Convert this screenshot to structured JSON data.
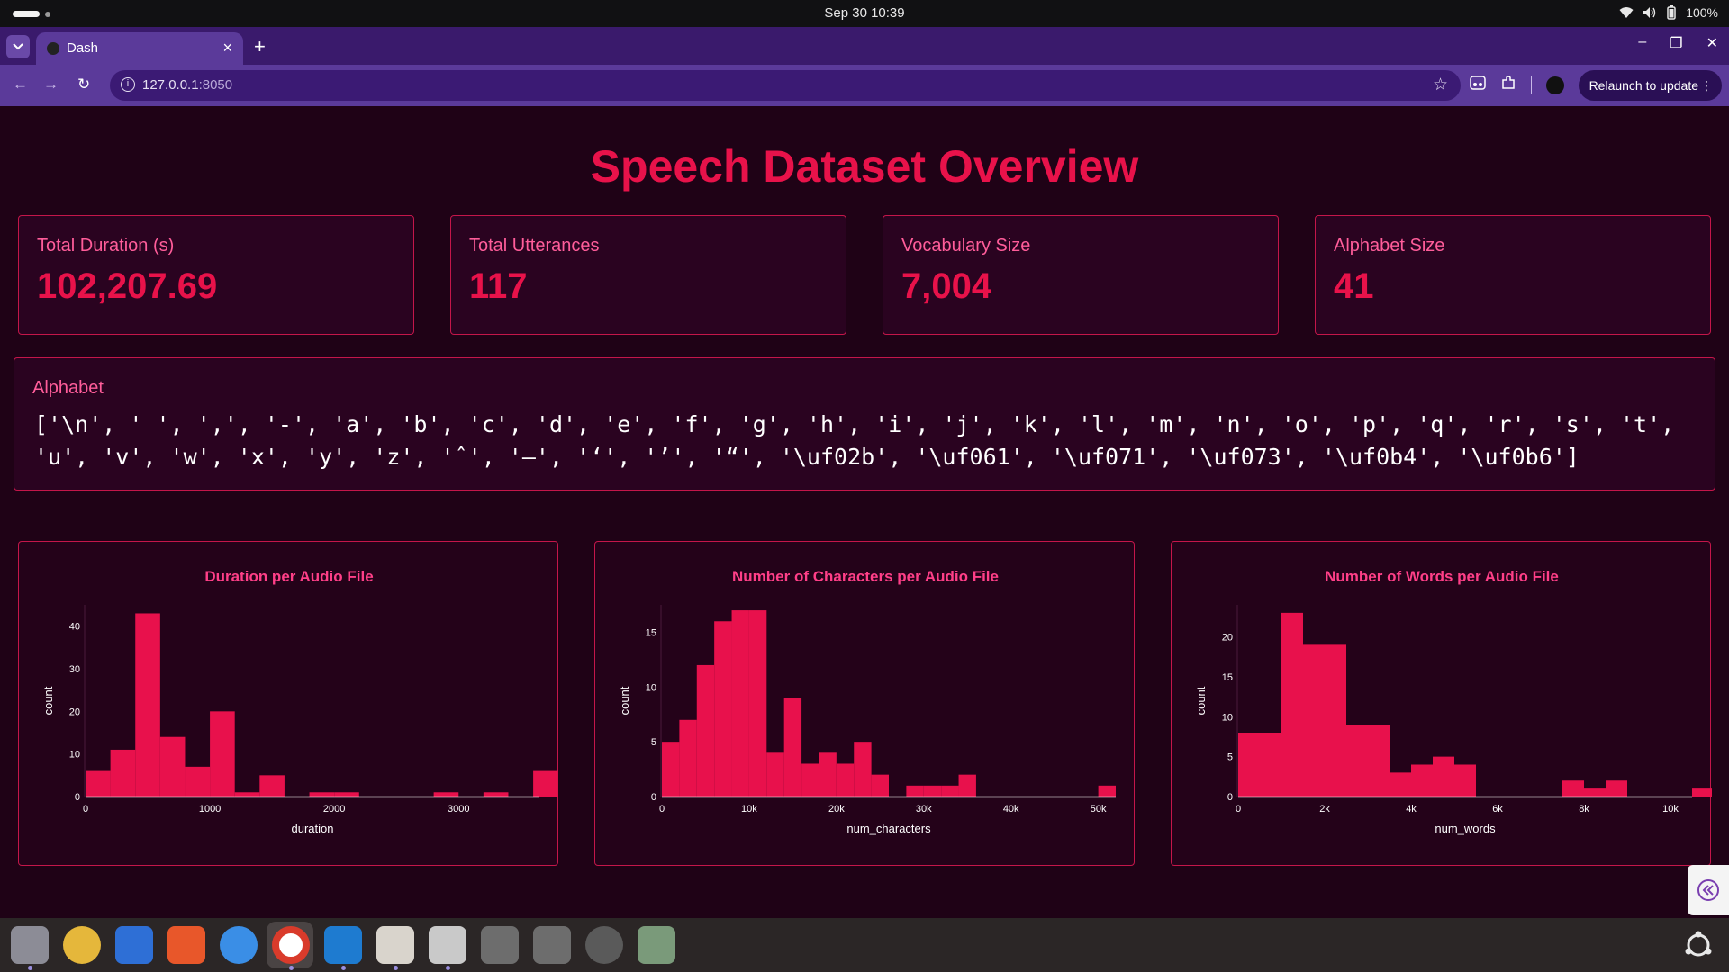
{
  "system": {
    "clock": "Sep 30  10:39",
    "battery": "100%"
  },
  "browser": {
    "tab_title": "Dash",
    "url_host": "127.0.0.1",
    "url_port": ":8050",
    "relaunch_label": "Relaunch to update"
  },
  "page": {
    "title": "Speech Dataset Overview",
    "stats": [
      {
        "label": "Total Duration (s)",
        "value": "102,207.69"
      },
      {
        "label": "Total Utterances",
        "value": "117"
      },
      {
        "label": "Vocabulary Size",
        "value": "7,004"
      },
      {
        "label": "Alphabet Size",
        "value": "41"
      }
    ],
    "alphabet": {
      "label": "Alphabet",
      "chars": "['\\n', ' ', ',', '-', 'a', 'b', 'c', 'd', 'e', 'f', 'g', 'h', 'i', 'j', 'k', 'l', 'm', 'n', 'o', 'p', 'q', 'r', 's', 't', 'u', 'v', 'w', 'x', 'y', 'z', 'ˆ', '—', '‘', '’', '“', '\\uf02b', '\\uf061', '\\uf071', '\\uf073', '\\uf0b4', '\\uf0b6']"
    }
  },
  "colors": {
    "accent": "#e8124a",
    "label": "#ff5d9a",
    "background": "#1f0216",
    "card": "#2a0320",
    "bar": "#e8114c"
  },
  "chart_data": [
    {
      "type": "bar",
      "title": "Duration per Audio File",
      "xlabel": "duration",
      "ylabel": "count",
      "xlim": [
        0,
        3650
      ],
      "ylim": [
        0,
        45
      ],
      "xticks": [
        0,
        1000,
        2000,
        3000
      ],
      "xtick_labels": [
        "0",
        "1000",
        "2000",
        "3000"
      ],
      "yticks": [
        0,
        10,
        20,
        30,
        40
      ],
      "bin_width": 200,
      "bin_start": 0,
      "values": [
        6,
        11,
        43,
        14,
        7,
        20,
        1,
        5,
        0,
        1,
        1,
        0,
        0,
        0,
        1,
        0,
        1,
        0,
        6
      ]
    },
    {
      "type": "bar",
      "title": "Number of Characters per Audio File",
      "xlabel": "num_characters",
      "ylabel": "count",
      "xlim": [
        0,
        52000
      ],
      "ylim": [
        0,
        17.5
      ],
      "xticks": [
        0,
        10000,
        20000,
        30000,
        40000,
        50000
      ],
      "xtick_labels": [
        "0",
        "10k",
        "20k",
        "30k",
        "40k",
        "50k"
      ],
      "yticks": [
        0,
        5,
        10,
        15
      ],
      "bin_width": 2000,
      "bin_start": 0,
      "values": [
        5,
        7,
        12,
        16,
        17,
        17,
        4,
        9,
        3,
        4,
        3,
        5,
        2,
        0,
        1,
        1,
        1,
        2,
        0,
        0,
        0,
        0,
        0,
        0,
        0,
        1
      ]
    },
    {
      "type": "bar",
      "title": "Number of Words per Audio File",
      "xlabel": "num_words",
      "ylabel": "count",
      "xlim": [
        0,
        10500
      ],
      "ylim": [
        0,
        24
      ],
      "xticks": [
        0,
        2000,
        4000,
        6000,
        8000,
        10000
      ],
      "xtick_labels": [
        "0",
        "2k",
        "4k",
        "6k",
        "8k",
        "10k"
      ],
      "yticks": [
        0,
        5,
        10,
        15,
        20
      ],
      "bin_width": 500,
      "bin_start": 0,
      "values": [
        8,
        8,
        23,
        19,
        19,
        9,
        9,
        3,
        4,
        5,
        4,
        0,
        0,
        0,
        0,
        2,
        1,
        2,
        0,
        0,
        0,
        1
      ]
    }
  ]
}
